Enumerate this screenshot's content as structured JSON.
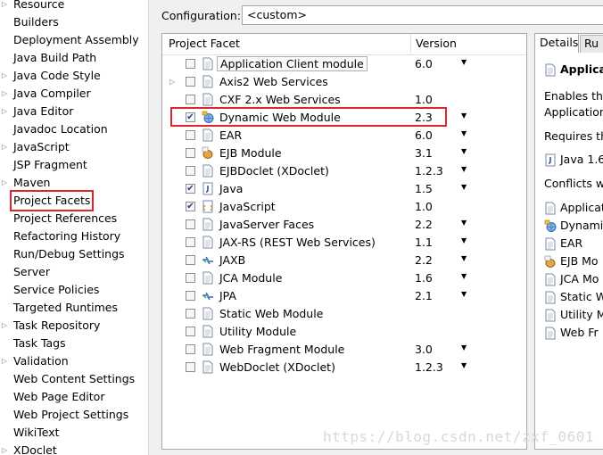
{
  "nav": {
    "items": [
      {
        "label": "Resource",
        "arrow": "▷"
      },
      {
        "label": "Builders",
        "arrow": ""
      },
      {
        "label": "Deployment Assembly",
        "arrow": ""
      },
      {
        "label": "Java Build Path",
        "arrow": ""
      },
      {
        "label": "Java Code Style",
        "arrow": "▷"
      },
      {
        "label": "Java Compiler",
        "arrow": "▷"
      },
      {
        "label": "Java Editor",
        "arrow": "▷"
      },
      {
        "label": "Javadoc Location",
        "arrow": ""
      },
      {
        "label": "JavaScript",
        "arrow": "▷"
      },
      {
        "label": "JSP Fragment",
        "arrow": ""
      },
      {
        "label": "Maven",
        "arrow": "▷"
      },
      {
        "label": "Project Facets",
        "arrow": "",
        "selected": true
      },
      {
        "label": "Project References",
        "arrow": ""
      },
      {
        "label": "Refactoring History",
        "arrow": ""
      },
      {
        "label": "Run/Debug Settings",
        "arrow": ""
      },
      {
        "label": "Server",
        "arrow": ""
      },
      {
        "label": "Service Policies",
        "arrow": ""
      },
      {
        "label": "Targeted Runtimes",
        "arrow": ""
      },
      {
        "label": "Task Repository",
        "arrow": "▷"
      },
      {
        "label": "Task Tags",
        "arrow": ""
      },
      {
        "label": "Validation",
        "arrow": "▷"
      },
      {
        "label": "Web Content Settings",
        "arrow": ""
      },
      {
        "label": "Web Page Editor",
        "arrow": ""
      },
      {
        "label": "Web Project Settings",
        "arrow": ""
      },
      {
        "label": "WikiText",
        "arrow": ""
      },
      {
        "label": "XDoclet",
        "arrow": "▷"
      }
    ]
  },
  "config": {
    "label": "Configuration:",
    "value": "<custom>"
  },
  "table": {
    "col_facet": "Project Facet",
    "col_version": "Version",
    "rows": [
      {
        "name": "Application Client module",
        "version": "6.0",
        "checked": false,
        "dropdown": true,
        "icon": "page",
        "boxed": true
      },
      {
        "name": "Axis2 Web Services",
        "version": "",
        "checked": false,
        "dropdown": false,
        "icon": "page",
        "expander": true
      },
      {
        "name": "CXF 2.x Web Services",
        "version": "1.0",
        "checked": false,
        "dropdown": false,
        "icon": "page"
      },
      {
        "name": "Dynamic Web Module",
        "version": "2.3",
        "checked": true,
        "dropdown": true,
        "icon": "globe"
      },
      {
        "name": "EAR",
        "version": "6.0",
        "checked": false,
        "dropdown": true,
        "icon": "page"
      },
      {
        "name": "EJB Module",
        "version": "3.1",
        "checked": false,
        "dropdown": true,
        "icon": "bean"
      },
      {
        "name": "EJBDoclet (XDoclet)",
        "version": "1.2.3",
        "checked": false,
        "dropdown": true,
        "icon": "page"
      },
      {
        "name": "Java",
        "version": "1.5",
        "checked": true,
        "dropdown": true,
        "icon": "java"
      },
      {
        "name": "JavaScript",
        "version": "1.0",
        "checked": true,
        "dropdown": false,
        "icon": "js"
      },
      {
        "name": "JavaServer Faces",
        "version": "2.2",
        "checked": false,
        "dropdown": true,
        "icon": "page"
      },
      {
        "name": "JAX-RS (REST Web Services)",
        "version": "1.1",
        "checked": false,
        "dropdown": true,
        "icon": "page"
      },
      {
        "name": "JAXB",
        "version": "2.2",
        "checked": false,
        "dropdown": true,
        "icon": "arrows"
      },
      {
        "name": "JCA Module",
        "version": "1.6",
        "checked": false,
        "dropdown": true,
        "icon": "page"
      },
      {
        "name": "JPA",
        "version": "2.1",
        "checked": false,
        "dropdown": true,
        "icon": "arrows"
      },
      {
        "name": "Static Web Module",
        "version": "",
        "checked": false,
        "dropdown": false,
        "icon": "page"
      },
      {
        "name": "Utility Module",
        "version": "",
        "checked": false,
        "dropdown": false,
        "icon": "page"
      },
      {
        "name": "Web Fragment Module",
        "version": "3.0",
        "checked": false,
        "dropdown": true,
        "icon": "page"
      },
      {
        "name": "WebDoclet (XDoclet)",
        "version": "1.2.3",
        "checked": false,
        "dropdown": true,
        "icon": "page"
      }
    ]
  },
  "details": {
    "tab_details": "Details",
    "tab_runtimes": "Ru",
    "title": "Applica",
    "enables_line1": "Enables the",
    "enables_line2": "Application",
    "requires": "Requires th",
    "requires_item": "Java 1.6",
    "conflicts": "Conflicts wit",
    "conflict_items": [
      {
        "label": "Applicat",
        "icon": "page"
      },
      {
        "label": "Dynami",
        "icon": "globe"
      },
      {
        "label": "EAR",
        "icon": "page"
      },
      {
        "label": "EJB Mo",
        "icon": "bean"
      },
      {
        "label": "JCA Mo",
        "icon": "page"
      },
      {
        "label": "Static W",
        "icon": "page"
      },
      {
        "label": "Utility M",
        "icon": "page"
      },
      {
        "label": "Web Fr",
        "icon": "page"
      }
    ]
  },
  "watermark": "https://blog.csdn.net/zxf_0601",
  "colors": {
    "highlight": "#e0262b",
    "background": "#f0f0f0"
  }
}
